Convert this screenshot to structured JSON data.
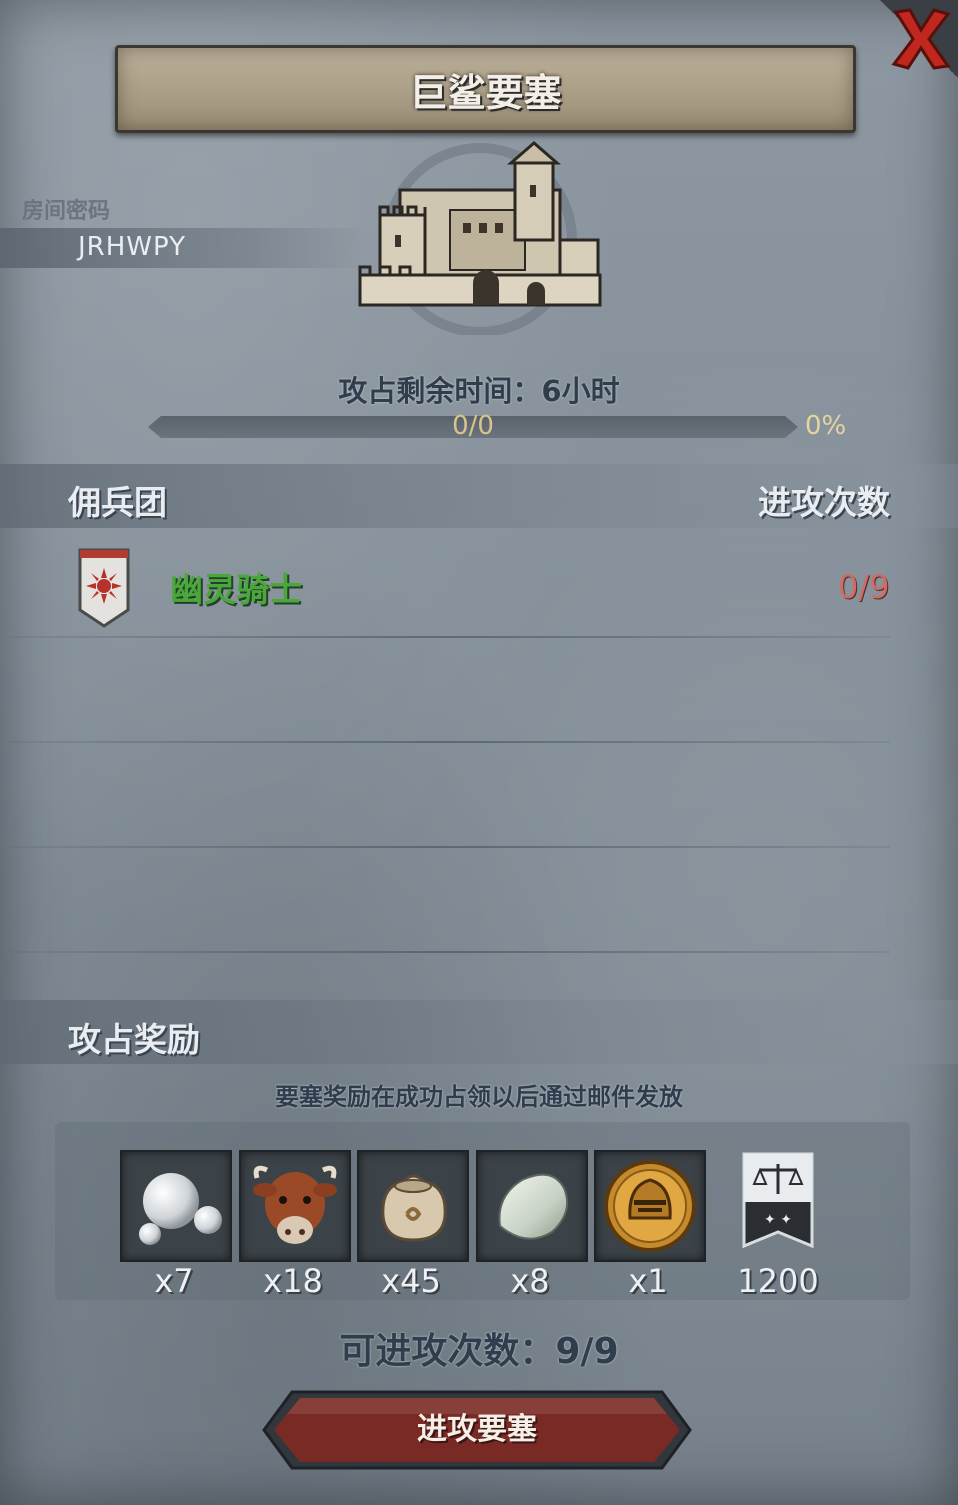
{
  "dialog": {
    "title": "巨鲨要塞",
    "close_icon": "close-x-icon"
  },
  "room": {
    "label": "房间密码",
    "code": "JRHWPY"
  },
  "fortress": {
    "icon": "castle-icon",
    "time_text": "攻占剩余时间：6小时",
    "progress_text": "0/0",
    "progress_percent_text": "0%",
    "progress_fraction": 0
  },
  "mercenary_section": {
    "title": "佣兵团",
    "attacks_header": "进攻次数",
    "rows": [
      {
        "icon": "sun-shield-icon",
        "name": "幽灵骑士",
        "count": "0/9"
      }
    ]
  },
  "reward_section": {
    "title": "攻占奖励",
    "note": "要塞奖励在成功占领以后通过邮件发放",
    "items": [
      {
        "icon": "pearl-icon",
        "qty": "x7"
      },
      {
        "icon": "cow-icon",
        "qty": "x18"
      },
      {
        "icon": "sack-icon",
        "qty": "x45"
      },
      {
        "icon": "stone-icon",
        "qty": "x8"
      },
      {
        "icon": "knight-helmet-coin-icon",
        "qty": "x1"
      },
      {
        "icon": "scales-banner-icon",
        "qty": "1200"
      }
    ]
  },
  "footer": {
    "attack_count": "可进攻次数：9/9",
    "attack_button": "进攻要塞"
  },
  "colors": {
    "merc_name": "#4aa83a",
    "merc_count": "#d06a62",
    "button": "#7a2a24"
  }
}
